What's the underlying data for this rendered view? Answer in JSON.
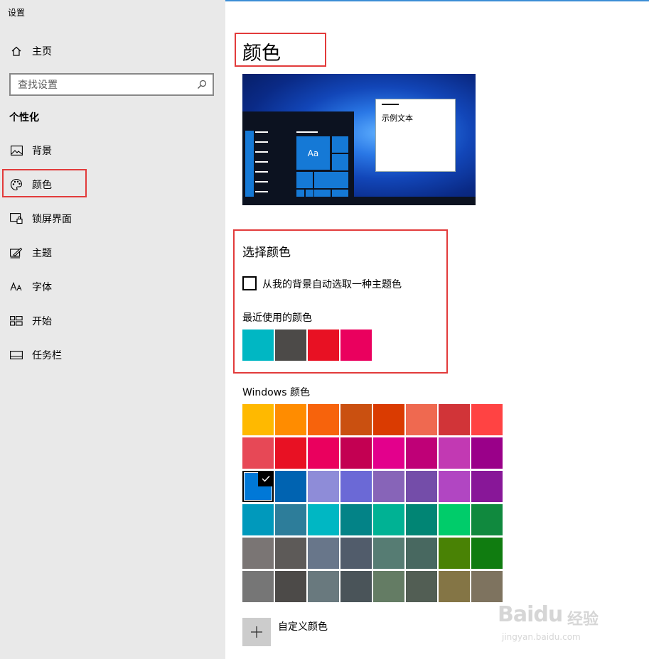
{
  "window": {
    "title": "设置"
  },
  "sidebar": {
    "home": {
      "label": "主页",
      "icon": "home-icon"
    },
    "search": {
      "placeholder": "查找设置",
      "icon": "search-icon"
    },
    "section_title": "个性化",
    "items": [
      {
        "label": "背景",
        "icon": "picture-icon"
      },
      {
        "label": "颜色",
        "icon": "palette-icon",
        "selected": true
      },
      {
        "label": "锁屏界面",
        "icon": "lock-screen-icon"
      },
      {
        "label": "主题",
        "icon": "theme-icon"
      },
      {
        "label": "字体",
        "icon": "font-icon"
      },
      {
        "label": "开始",
        "icon": "start-icon"
      },
      {
        "label": "任务栏",
        "icon": "taskbar-icon"
      }
    ]
  },
  "main": {
    "title": "颜色",
    "preview": {
      "sample_text": "示例文本",
      "tile_label": "Aa"
    },
    "choose": {
      "heading": "选择颜色",
      "auto_checkbox_label": "从我的背景自动选取一种主题色",
      "auto_checked": false,
      "recent_label": "最近使用的颜色",
      "recent_colors": [
        "#00b7c3",
        "#4c4a48",
        "#e81123",
        "#ea005e"
      ]
    },
    "windows_colors": {
      "label": "Windows 颜色",
      "selected": "#0078d7",
      "rows": [
        [
          "#ffb900",
          "#ff8c00",
          "#f7630c",
          "#ca5010",
          "#da3b01",
          "#ef6950",
          "#d13438",
          "#ff4343"
        ],
        [
          "#e74856",
          "#e81123",
          "#ea005e",
          "#c30052",
          "#e3008c",
          "#bf0077",
          "#c239b3",
          "#9a0089"
        ],
        [
          "#0078d7",
          "#0063b1",
          "#8e8cd8",
          "#6b69d6",
          "#8764b8",
          "#744da9",
          "#b146c2",
          "#881798"
        ],
        [
          "#0099bc",
          "#2d7d9a",
          "#00b7c3",
          "#038387",
          "#00b294",
          "#018574",
          "#00cc6a",
          "#10893e"
        ],
        [
          "#7a7574",
          "#5d5a58",
          "#68768a",
          "#515c6b",
          "#567c73",
          "#486860",
          "#498205",
          "#107c10"
        ],
        [
          "#767676",
          "#4c4a48",
          "#69797e",
          "#4a5459",
          "#647c64",
          "#525e54",
          "#847545",
          "#7e735f"
        ]
      ]
    },
    "custom_color_label": "自定义颜色"
  },
  "watermark": {
    "brand": "Baidu",
    "product": "经验",
    "url": "jingyan.baidu.com"
  },
  "colors": {
    "highlight_border": "#e23b3b",
    "accent": "#0078d7"
  }
}
